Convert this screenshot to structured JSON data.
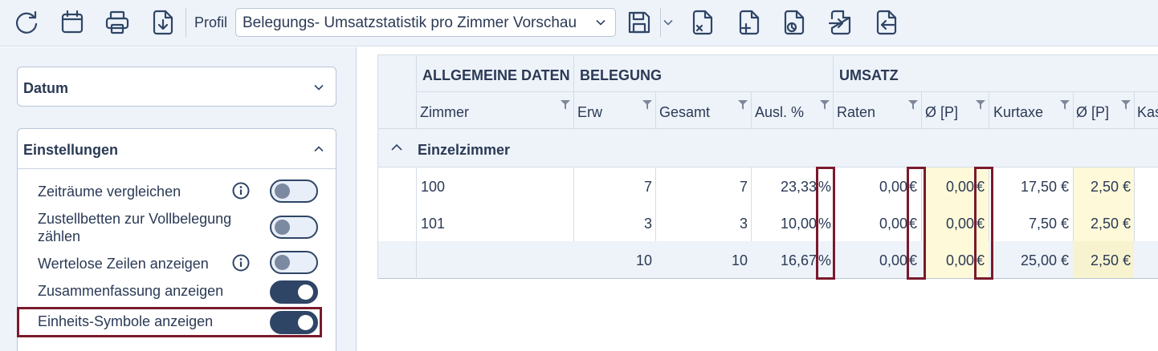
{
  "toolbar": {
    "icons": [
      "refresh-icon",
      "calendar-icon",
      "printer-icon",
      "download-file-icon",
      "save-icon",
      "file-remove-icon",
      "file-add-icon",
      "file-copy-icon",
      "file-import-icon",
      "file-export-icon"
    ],
    "profil_label": "Profil",
    "profil_value": "Belegungs- Umsatzstatistik pro Zimmer Vorschau"
  },
  "left": {
    "datum_title": "Datum",
    "einstellungen_title": "Einstellungen",
    "options": [
      {
        "label": "Zeiträume vergleichen",
        "info": true,
        "on": false
      },
      {
        "label": "Zustellbetten zur Vollbelegung zählen",
        "info": false,
        "on": false
      },
      {
        "label": "Wertelose Zeilen anzeigen",
        "info": true,
        "on": false
      },
      {
        "label": "Zusammenfassung anzeigen",
        "info": false,
        "on": true
      },
      {
        "label": "Einheits-Symbole anzeigen",
        "info": false,
        "on": true
      }
    ]
  },
  "grid": {
    "groups": [
      "ALLGEMEINE DATEN",
      "BELEGUNG",
      "UMSATZ"
    ],
    "columns": [
      "Zimmer",
      "Erw",
      "Gesamt",
      "Ausl. %",
      "Raten",
      "Ø [P]",
      "Kurtaxe",
      "Ø [P]",
      "Kas"
    ],
    "category": "Einzelzimmer",
    "rows": [
      {
        "zimmer": "100",
        "erw": "7",
        "gesamt": "7",
        "ausl": "23,33",
        "ausl_unit": "%",
        "raten": "0,00",
        "raten_unit": "€",
        "raten_p": "0,00",
        "raten_p_unit": "€",
        "kurtaxe": "17,50 €",
        "kurtaxe_p": "2,50 €"
      },
      {
        "zimmer": "101",
        "erw": "3",
        "gesamt": "3",
        "ausl": "10,00",
        "ausl_unit": "%",
        "raten": "0,00",
        "raten_unit": "€",
        "raten_p": "0,00",
        "raten_p_unit": "€",
        "kurtaxe": "7,50 €",
        "kurtaxe_p": "2,50 €"
      }
    ],
    "summary": {
      "erw": "10",
      "gesamt": "10",
      "ausl": "16,67",
      "ausl_unit": "%",
      "raten": "0,00",
      "raten_unit": "€",
      "raten_p": "0,00",
      "raten_p_unit": "€",
      "kurtaxe": "25,00 €",
      "kurtaxe_p": "2,50 €"
    }
  },
  "colors": {
    "primary": "#2f4566",
    "panel_bg": "#eef3fa",
    "highlight": "#7a1a2c",
    "yellow_cell": "#fdf9d9"
  }
}
